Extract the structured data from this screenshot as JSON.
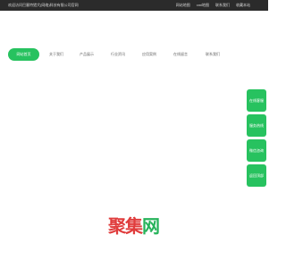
{
  "topbar": {
    "title": "欢迎访问巴塞特猎犬(网络)科技有限公司官网",
    "links": [
      "网站地图",
      "xml地图",
      "联系我们",
      "收藏本站"
    ]
  },
  "nav": {
    "items": [
      "网站首页",
      "关于我们",
      "产品展示",
      "行业资讯",
      "应用案例",
      "在线留言",
      "联系我们"
    ],
    "active_index": 0
  },
  "side_panel": {
    "items": [
      "在线客服",
      "服务热线",
      "微信咨询",
      "返回顶部"
    ]
  },
  "watermark": {
    "text": "聚集网"
  },
  "colors": {
    "accent": "#27c25f",
    "topbar_bg": "#2b2b2b",
    "watermark_red": "#e03c3c",
    "watermark_green": "#27b35b"
  }
}
